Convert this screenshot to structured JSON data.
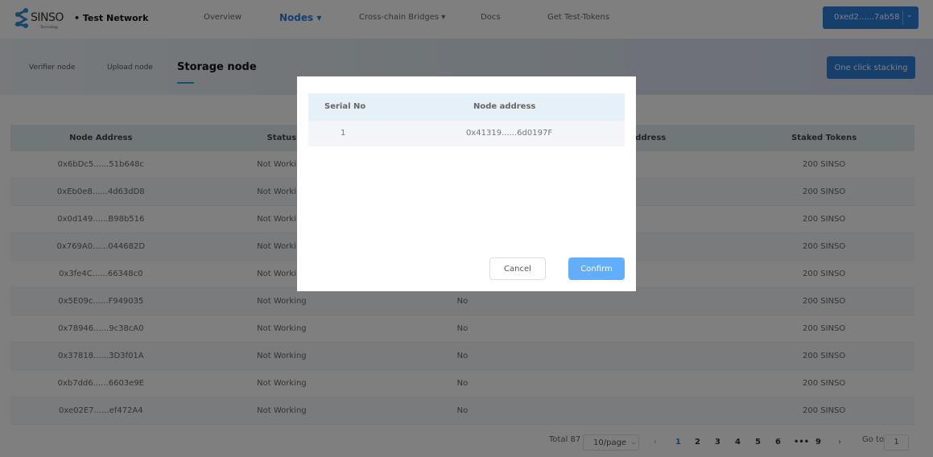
{
  "header": {
    "logo": "SINSO",
    "logo_sub": "Technology",
    "network": "• Test Network",
    "nav": [
      {
        "label": "Overview"
      },
      {
        "label": "Nodes ▾"
      },
      {
        "label": "Cross-chain Bridges ▾"
      },
      {
        "label": "Docs"
      },
      {
        "label": "Get Test-Tokens"
      }
    ],
    "wallet": "0xed2......7ab58"
  },
  "subtabs": [
    {
      "label": "Verifier node"
    },
    {
      "label": "Upload node"
    },
    {
      "label": "Storage node"
    }
  ],
  "stack_button": "One click stacking",
  "table": {
    "headers": [
      "Node Address",
      "Status",
      "",
      "g Address",
      "Staked Tokens"
    ],
    "rows": [
      [
        "0x6bDc5......51b648c",
        "Not Working",
        "",
        "",
        "200 SINSO"
      ],
      [
        "0xEb0e8......4d63dD8",
        "Not Working",
        "",
        "",
        "200 SINSO"
      ],
      [
        "0x0d149......B98b516",
        "Not Working",
        "",
        "",
        "200 SINSO"
      ],
      [
        "0x769A0......044682D",
        "Not Working",
        "",
        "",
        "200 SINSO"
      ],
      [
        "0x3fe4C......66348c0",
        "Not Working",
        "",
        "",
        "200 SINSO"
      ],
      [
        "0x5E09c......F949035",
        "Not Working",
        "No",
        "",
        "200 SINSO"
      ],
      [
        "0x78946......9c38cA0",
        "Not Working",
        "No",
        "",
        "200 SINSO"
      ],
      [
        "0x37818......3D3f01A",
        "Not Working",
        "No",
        "",
        "200 SINSO"
      ],
      [
        "0xb7dd6......6603e9E",
        "Not Working",
        "No",
        "",
        "200 SINSO"
      ],
      [
        "0xe02E7......ef472A4",
        "Not Working",
        "No",
        "",
        "200 SINSO"
      ]
    ]
  },
  "pagination": {
    "total": "Total 87",
    "page_size": "10/page",
    "pages": [
      "1",
      "2",
      "3",
      "4",
      "5",
      "6",
      "•••",
      "9"
    ],
    "current": "1",
    "goto_label": "Go to",
    "goto_value": "1"
  },
  "modal": {
    "headers": [
      "Serial No",
      "Node address"
    ],
    "rows": [
      [
        "1",
        "0x41319......6d0197F"
      ]
    ],
    "cancel": "Cancel",
    "confirm": "Confirm"
  }
}
